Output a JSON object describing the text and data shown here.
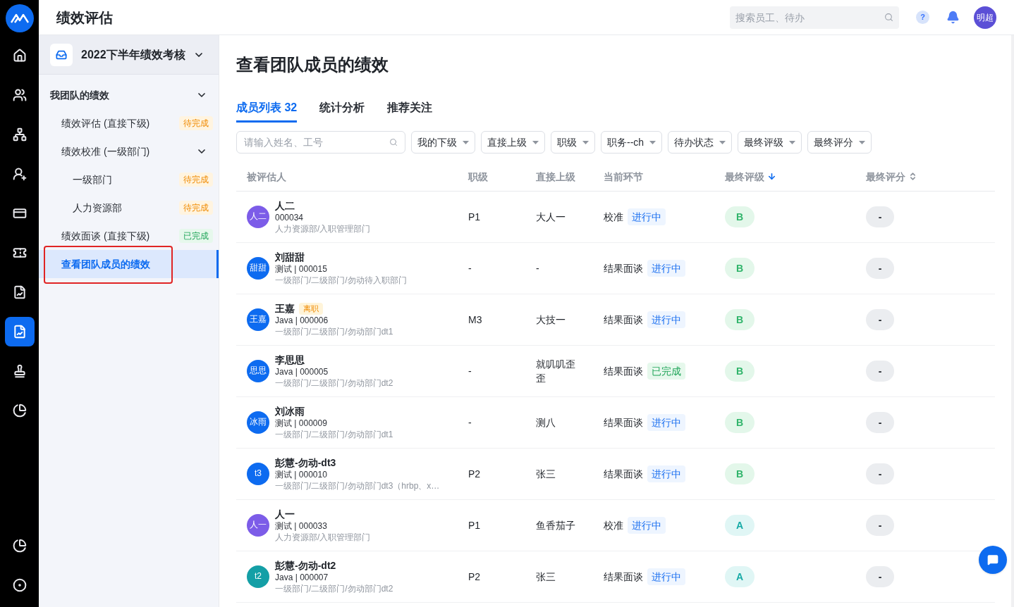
{
  "app": {
    "title": "绩效评估"
  },
  "header": {
    "search_placeholder": "搜索员工、待办",
    "help": "?",
    "avatar": "明超"
  },
  "rail": [
    {
      "kind": "home",
      "selected": false
    },
    {
      "kind": "users",
      "selected": false
    },
    {
      "kind": "org",
      "selected": false
    },
    {
      "kind": "user_add",
      "selected": false
    },
    {
      "kind": "card",
      "selected": false
    },
    {
      "kind": "ticket",
      "selected": false
    },
    {
      "kind": "report",
      "selected": false
    },
    {
      "kind": "report",
      "selected": true
    },
    {
      "kind": "stamp",
      "selected": false
    },
    {
      "kind": "pie",
      "selected": false
    }
  ],
  "rail_bottom": [
    {
      "kind": "pie",
      "selected": false
    },
    {
      "kind": "gear",
      "selected": false
    }
  ],
  "sidebar": {
    "cycle": "2022下半年绩效考核",
    "groups": [
      {
        "label": "我团队的绩效",
        "expanded": true,
        "children": [
          {
            "label": "绩效评估 (直接下级)",
            "badge": {
              "text": "待完成",
              "kind": "pending"
            },
            "selected": false
          },
          {
            "label": "绩效校准 (一级部门)",
            "expanded": true,
            "selected": false,
            "children": [
              {
                "label": "一级部门",
                "badge": {
                  "text": "待完成",
                  "kind": "pending"
                },
                "selected": false
              },
              {
                "label": "人力资源部",
                "badge": {
                  "text": "待完成",
                  "kind": "pending"
                },
                "selected": false
              }
            ]
          },
          {
            "label": "绩效面谈 (直接下级)",
            "badge": {
              "text": "已完成",
              "kind": "done"
            },
            "selected": false
          },
          {
            "label": "查看团队成员的绩效",
            "selected": true,
            "annotated": true
          }
        ]
      }
    ]
  },
  "page": {
    "title": "查看团队成员的绩效",
    "tabs": [
      {
        "label": "成员列表 32",
        "selected": true
      },
      {
        "label": "统计分析",
        "selected": false
      },
      {
        "label": "推荐关注",
        "selected": false
      }
    ],
    "search": {
      "placeholder": "请输入姓名、工号"
    },
    "filters": [
      "我的下级",
      "直接上级",
      "职级",
      "职务--ch",
      "待办状态",
      "最终评级",
      "最终评分"
    ],
    "table": {
      "columns": [
        {
          "label": "被评估人",
          "kind": "plain"
        },
        {
          "label": "职级",
          "kind": "plain"
        },
        {
          "label": "直接上级",
          "kind": "plain"
        },
        {
          "label": "当前环节",
          "kind": "plain"
        },
        {
          "label": "最终评级",
          "kind": "sorted_desc"
        },
        {
          "label": "最终评分",
          "kind": "sortable"
        }
      ],
      "rows": [
        {
          "avatar": "人二",
          "color": "#7c5ce8",
          "name": "人二",
          "meta": "000034",
          "dept": "人力资源部/入职管理部门",
          "level": "P1",
          "manager": "大人一",
          "stage": "校准",
          "status": {
            "text": "进行中",
            "kind": "in_progress"
          },
          "grade": {
            "text": "B",
            "kind": "b"
          },
          "score": "-"
        },
        {
          "avatar": "甜甜",
          "color": "#0d6bf0",
          "name": "刘甜甜",
          "meta": "测试 | 000015",
          "dept": "一级部门/二级部门/勿动待入职部门",
          "level": "-",
          "manager": "-",
          "stage": "结果面谈",
          "status": {
            "text": "进行中",
            "kind": "in_progress"
          },
          "grade": {
            "text": "B",
            "kind": "b"
          },
          "score": "-"
        },
        {
          "avatar": "王嘉",
          "color": "#0d6bf0",
          "name": "王嘉",
          "tag": "离职",
          "meta": "Java | 000006",
          "dept": "一级部门/二级部门/勿动部门dt1",
          "level": "M3",
          "manager": "大技一",
          "stage": "结果面谈",
          "status": {
            "text": "进行中",
            "kind": "in_progress"
          },
          "grade": {
            "text": "B",
            "kind": "b"
          },
          "score": "-"
        },
        {
          "avatar": "思思",
          "color": "#0d6bf0",
          "name": "李思思",
          "meta": "Java | 000005",
          "dept": "一级部门/二级部门/勿动部门dt2",
          "level": "-",
          "manager": "就叽叽歪歪",
          "stage": "结果面谈",
          "status": {
            "text": "已完成",
            "kind": "done"
          },
          "grade": {
            "text": "B",
            "kind": "b"
          },
          "score": "-"
        },
        {
          "avatar": "冰雨",
          "color": "#0d6bf0",
          "name": "刘冰雨",
          "meta": "测试 | 000009",
          "dept": "一级部门/二级部门/勿动部门dt1",
          "level": "-",
          "manager": "测八",
          "stage": "结果面谈",
          "status": {
            "text": "进行中",
            "kind": "in_progress"
          },
          "grade": {
            "text": "B",
            "kind": "b"
          },
          "score": "-"
        },
        {
          "avatar": "t3",
          "color": "#0d6bf0",
          "name": "彭慧-勿动-dt3",
          "meta": "测试 | 000010",
          "dept": "一级部门/二级部门/勿动部门dt3（hrbp、x…",
          "level": "P2",
          "manager": "张三",
          "stage": "结果面谈",
          "status": {
            "text": "进行中",
            "kind": "in_progress"
          },
          "grade": {
            "text": "B",
            "kind": "b"
          },
          "score": "-"
        },
        {
          "avatar": "人一",
          "color": "#7c5ce8",
          "name": "人一",
          "meta": "测试 | 000033",
          "dept": "人力资源部/入职管理部门",
          "level": "P1",
          "manager": "鱼香茄子",
          "stage": "校准",
          "status": {
            "text": "进行中",
            "kind": "in_progress"
          },
          "grade": {
            "text": "A",
            "kind": "a"
          },
          "score": "-"
        },
        {
          "avatar": "t2",
          "color": "#149fa6",
          "name": "彭慧-勿动-dt2",
          "meta": "Java | 000007",
          "dept": "一级部门/二级部门/勿动部门dt2",
          "level": "P2",
          "manager": "张三",
          "stage": "结果面谈",
          "status": {
            "text": "进行中",
            "kind": "in_progress"
          },
          "grade": {
            "text": "A",
            "kind": "a"
          },
          "score": "-"
        }
      ]
    }
  }
}
